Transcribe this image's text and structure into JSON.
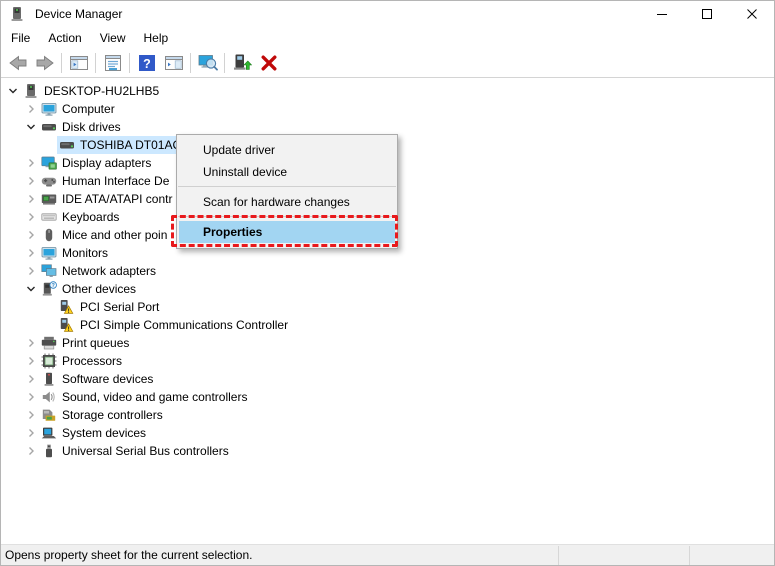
{
  "window": {
    "title": "Device Manager",
    "status": "Opens property sheet for the current selection."
  },
  "menubar": [
    "File",
    "Action",
    "View",
    "Help"
  ],
  "toolbar": [
    {
      "icon": "back"
    },
    {
      "icon": "forward"
    },
    {
      "sep": true
    },
    {
      "icon": "console-tree"
    },
    {
      "sep": true
    },
    {
      "icon": "properties"
    },
    {
      "sep": true
    },
    {
      "icon": "help"
    },
    {
      "icon": "action-pane"
    },
    {
      "sep": true
    },
    {
      "icon": "scan-hardware-changes"
    },
    {
      "sep": true
    },
    {
      "icon": "update-driver"
    },
    {
      "icon": "uninstall-device"
    }
  ],
  "tree": [
    {
      "label": "DESKTOP-HU2LHB5",
      "level": 0,
      "state": "expanded",
      "icon": "computer"
    },
    {
      "label": "Computer",
      "level": 1,
      "state": "collapsed",
      "icon": "monitor"
    },
    {
      "label": "Disk drives",
      "level": 1,
      "state": "expanded",
      "icon": "disk"
    },
    {
      "label": "TOSHIBA DT01AC",
      "level": 2,
      "state": "none",
      "icon": "disk",
      "selected": true
    },
    {
      "label": "Display adapters",
      "level": 1,
      "state": "collapsed",
      "icon": "display"
    },
    {
      "label": "Human Interface De",
      "level": 1,
      "state": "collapsed",
      "icon": "hid"
    },
    {
      "label": "IDE ATA/ATAPI contr",
      "level": 1,
      "state": "collapsed",
      "icon": "ide"
    },
    {
      "label": "Keyboards",
      "level": 1,
      "state": "collapsed",
      "icon": "keyboard"
    },
    {
      "label": "Mice and other poin",
      "level": 1,
      "state": "collapsed",
      "icon": "mouse"
    },
    {
      "label": "Monitors",
      "level": 1,
      "state": "collapsed",
      "icon": "monitor"
    },
    {
      "label": "Network adapters",
      "level": 1,
      "state": "collapsed",
      "icon": "network"
    },
    {
      "label": "Other devices",
      "level": 1,
      "state": "expanded",
      "icon": "unknown-device"
    },
    {
      "label": "PCI Serial Port",
      "level": 2,
      "state": "none",
      "icon": "warning-device"
    },
    {
      "label": "PCI Simple Communications Controller",
      "level": 2,
      "state": "none",
      "icon": "warning-device"
    },
    {
      "label": "Print queues",
      "level": 1,
      "state": "collapsed",
      "icon": "printer"
    },
    {
      "label": "Processors",
      "level": 1,
      "state": "collapsed",
      "icon": "processor"
    },
    {
      "label": "Software devices",
      "level": 1,
      "state": "collapsed",
      "icon": "software"
    },
    {
      "label": "Sound, video and game controllers",
      "level": 1,
      "state": "collapsed",
      "icon": "sound"
    },
    {
      "label": "Storage controllers",
      "level": 1,
      "state": "collapsed",
      "icon": "storage"
    },
    {
      "label": "System devices",
      "level": 1,
      "state": "collapsed",
      "icon": "system"
    },
    {
      "label": "Universal Serial Bus controllers",
      "level": 1,
      "state": "collapsed",
      "icon": "usb"
    }
  ],
  "context_menu": {
    "items": [
      {
        "label": "Update driver"
      },
      {
        "label": "Uninstall device"
      },
      {
        "separator": true
      },
      {
        "label": "Scan for hardware changes"
      },
      {
        "separator": true
      },
      {
        "label": "Properties",
        "highlighted": true,
        "annotated": true
      }
    ]
  },
  "colors": {
    "tree_selection": "#cce8ff",
    "menu_highlight": "#a2d5f2",
    "annotation_red": "#e8191c",
    "menu_bg": "#f2f2f2",
    "status_bg": "#f0f0f0"
  }
}
